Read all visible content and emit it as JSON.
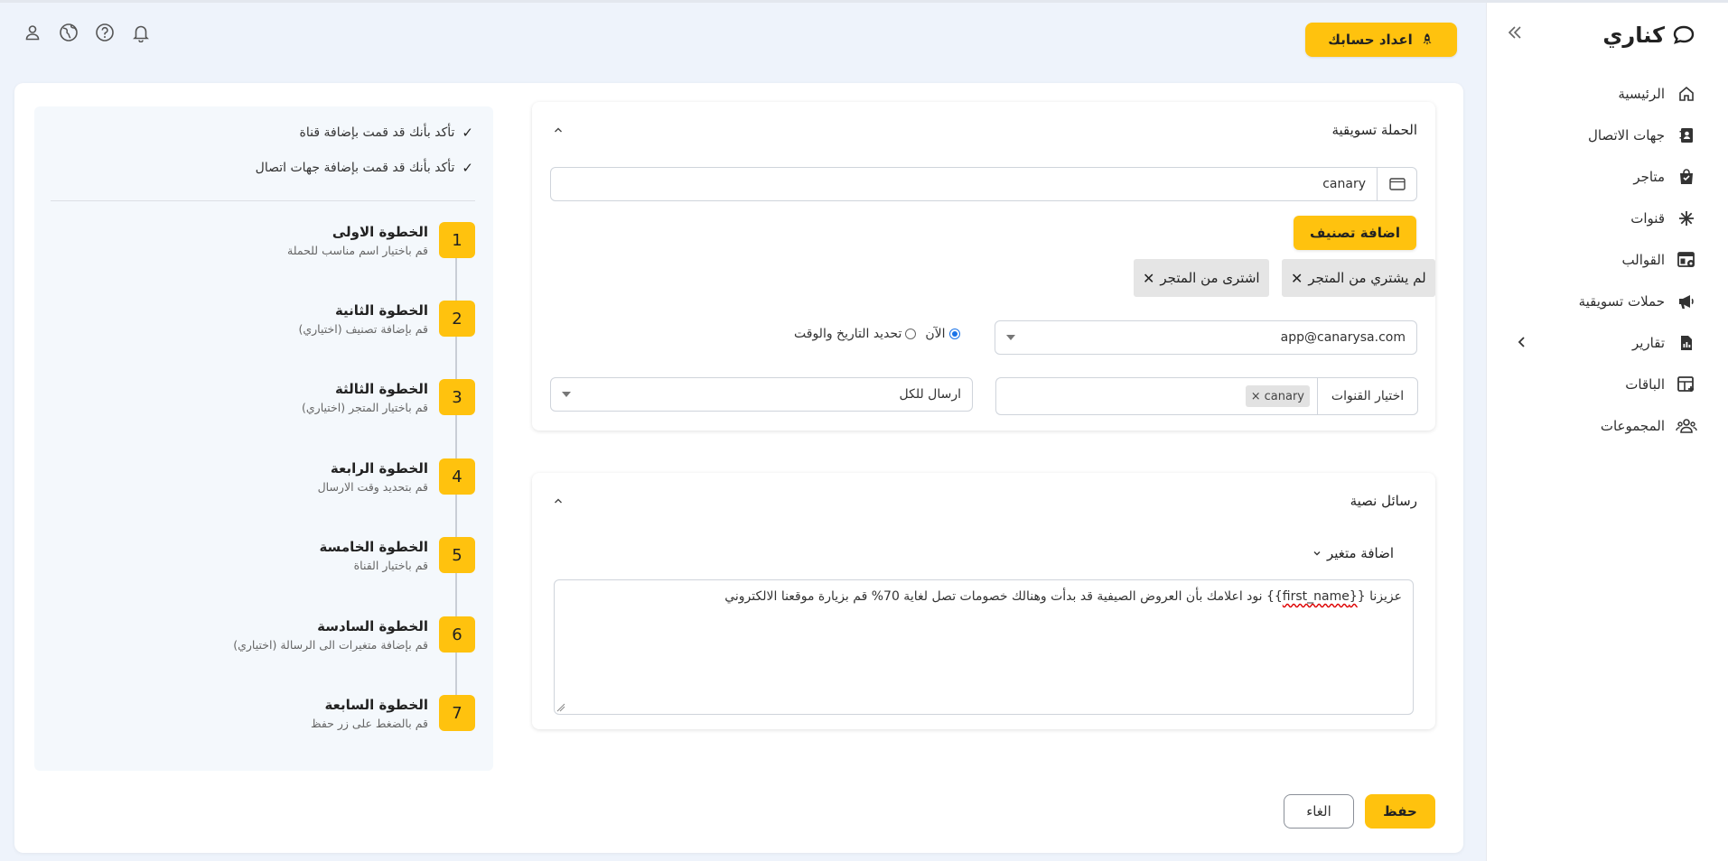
{
  "sidebar": {
    "brand": "كناري",
    "items": [
      {
        "label": "الرئيسية",
        "icon": "home-icon"
      },
      {
        "label": "جهات الاتصال",
        "icon": "contacts-book-icon"
      },
      {
        "label": "متاجر",
        "icon": "shopping-bag-icon"
      },
      {
        "label": "قنوات",
        "icon": "asterisk-icon"
      },
      {
        "label": "القوالب",
        "icon": "template-gear-icon"
      },
      {
        "label": "حملات تسويقية",
        "icon": "megaphone-icon"
      },
      {
        "label": "تقارير",
        "icon": "report-file-icon"
      },
      {
        "label": "الباقات",
        "icon": "packages-table-icon"
      },
      {
        "label": "المجموعات",
        "icon": "groups-icon"
      }
    ]
  },
  "topbar": {
    "setup_label": "اعداد حسابك"
  },
  "steps_panel": {
    "checks": [
      "تأكد بأنك قد قمت بإضافة قناة",
      "تأكد بأنك قد قمت بإضافة جهات اتصال"
    ],
    "steps": [
      {
        "num": "1",
        "title": "الخطوة الاولى",
        "desc": "قم باختيار اسم مناسب للحملة"
      },
      {
        "num": "2",
        "title": "الخطوة الثانية",
        "desc": "قم بإضافة تصنيف (اختياري)"
      },
      {
        "num": "3",
        "title": "الخطوة الثالثة",
        "desc": "قم باختيار المتجر (اختياري)"
      },
      {
        "num": "4",
        "title": "الخطوة الرابعة",
        "desc": "قم بتحديد وقت الارسال"
      },
      {
        "num": "5",
        "title": "الخطوة الخامسة",
        "desc": "قم باختيار القناة"
      },
      {
        "num": "6",
        "title": "الخطوة السادسة",
        "desc": "قم بإضافة متغيرات الى الرسالة (اختياري)"
      },
      {
        "num": "7",
        "title": "الخطوة السابعة",
        "desc": "قم بالضغط على زر حفظ"
      }
    ]
  },
  "campaign": {
    "title": "الحملة تسويقية",
    "name_value": "canary",
    "add_category_label": "اضافة تصنيف",
    "tags": [
      "لم يشتري من المتجر",
      "اشترى من المتجر"
    ],
    "email_value": "app@canarysa.com",
    "radio_now": "الآن",
    "radio_schedule": "تحديد التاريخ والوقت",
    "channels_label": "اختيار القنوات",
    "channel_chip": "canary",
    "send_to_value": "ارسال للكل"
  },
  "sms": {
    "title": "رسائل نصية",
    "add_variable_label": "اضافة متغير",
    "message_prefix": "عزيزنا  {",
    "message_var": "{first_name",
    "message_suffix": "}} نود اعلامك بأن العروض الصيفية قد بدأت وهنالك خصومات تصل لغاية 70% قم بزيارة موقعنا الالكتروني"
  },
  "actions": {
    "save_label": "حفظ",
    "cancel_label": "الغاء"
  },
  "colors": {
    "accent": "#ffc20e",
    "background": "#eef3fb"
  }
}
